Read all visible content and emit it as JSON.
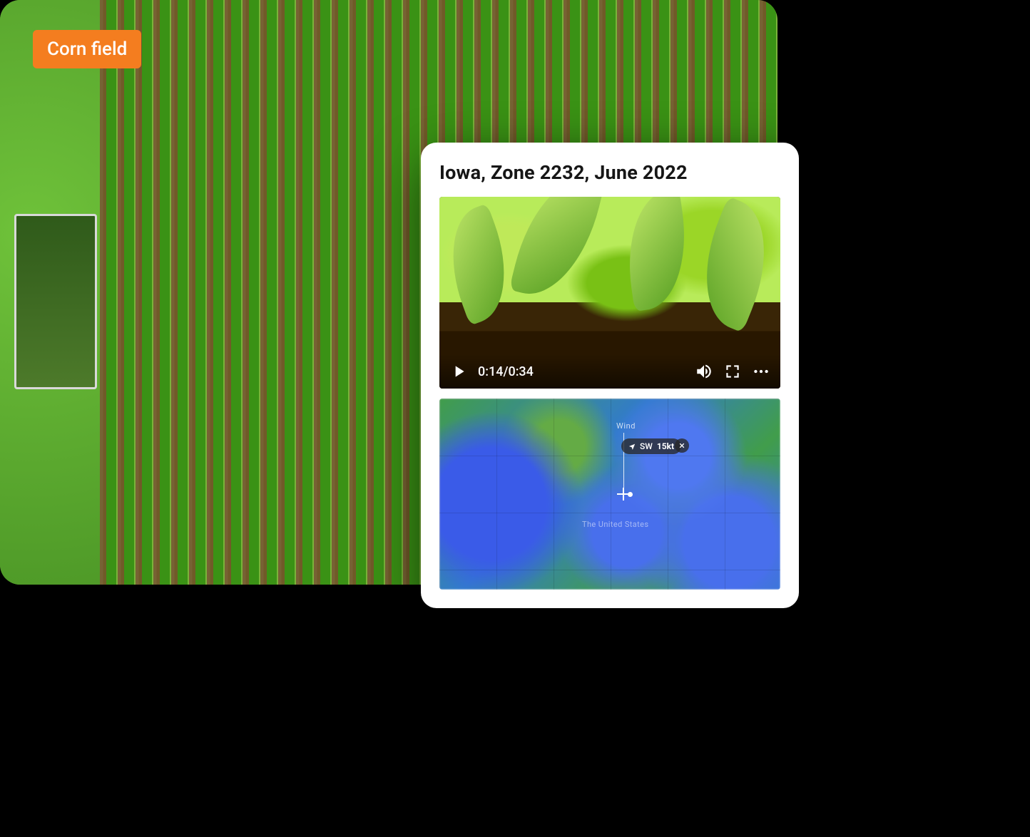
{
  "chip": {
    "label": "Corn field"
  },
  "card": {
    "title": "Iowa, Zone 2232, June 2022",
    "video": {
      "timecode": "0:14/0:34"
    },
    "map": {
      "wind_title": "Wind",
      "wind_dir": "SW",
      "wind_speed": "15kt",
      "country_label": "The United States"
    }
  }
}
